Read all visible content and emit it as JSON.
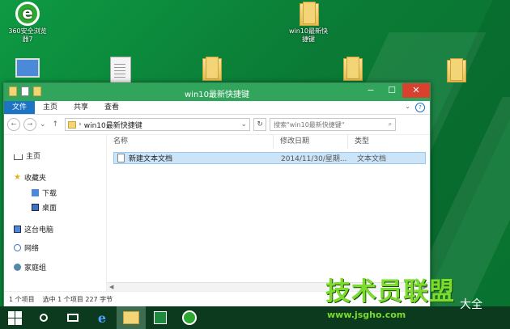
{
  "desktop": {
    "icons": [
      {
        "label": "360安全浏览\n器7",
        "icon": "browser-360-icon"
      },
      {
        "label": "win10最新快\n捷键",
        "icon": "folder-icon"
      },
      {
        "label": "",
        "icon": "this-pc-icon"
      },
      {
        "label": "",
        "icon": "document-icon"
      },
      {
        "label": "",
        "icon": "folder-icon"
      },
      {
        "label": "",
        "icon": "folder-icon"
      },
      {
        "label": "",
        "icon": "folder-icon"
      }
    ]
  },
  "window": {
    "title": "win10最新快捷键",
    "controls": {
      "minimize": "−",
      "maximize": "☐",
      "close": "✕"
    },
    "ribbon_tabs": [
      "文件",
      "主页",
      "共享",
      "查看"
    ],
    "address": {
      "back": "←",
      "forward": "→",
      "recent": "⌄",
      "up": "↑",
      "separator": "›",
      "path": "win10最新快捷键",
      "dropdown": "⌄",
      "refresh": "↻"
    },
    "search": {
      "placeholder": "搜索\"win10最新快捷键\"",
      "icon": "⌕"
    },
    "nav": {
      "home": "主页",
      "favorites": "收藏夹",
      "downloads": "下载",
      "desktop": "桌面",
      "this_pc": "这台电脑",
      "network": "网络",
      "homegroup": "家庭组"
    },
    "columns": [
      "名称",
      "修改日期",
      "类型"
    ],
    "files": [
      {
        "name": "新建文本文档",
        "date": "2014/11/30/星期...",
        "type": "文本文档"
      }
    ],
    "status": {
      "count": "1 个项目",
      "selected": "选中 1 个项目 227 字节"
    }
  },
  "watermark": {
    "main": "技术员联盟",
    "url": "www.jsgho.com",
    "tail": "大全"
  },
  "colors": {
    "titlebar": "#32a55c",
    "file_tab": "#1e74c4",
    "close": "#d9412f",
    "desktop": "#0e9a43",
    "taskbar": "#0b3a1e",
    "watermark": "#7bdc2c"
  }
}
